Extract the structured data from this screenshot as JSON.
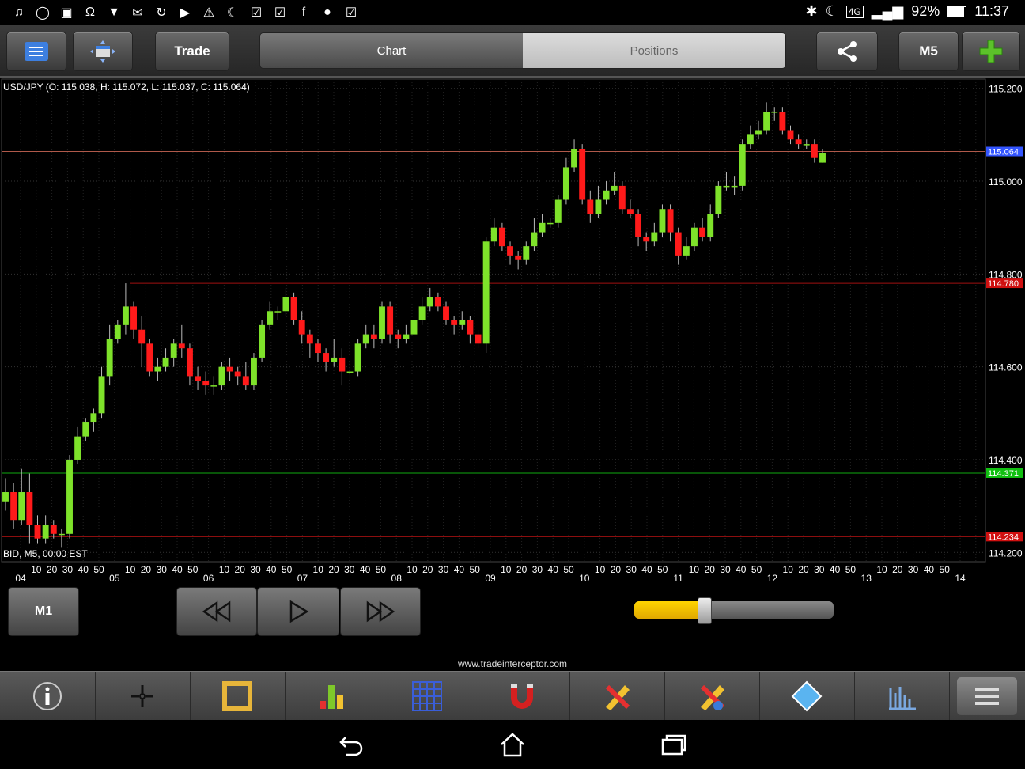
{
  "status_bar": {
    "left_icons": [
      "music-icon",
      "no-sim-icon",
      "image-icon",
      "headset-icon",
      "wifi-question-icon",
      "gmail-icon",
      "sync-icon",
      "youtube-icon",
      "warning-icon",
      "moon-icon",
      "task-icon",
      "task-check-icon",
      "facebook-icon",
      "messenger-icon",
      "task-done-icon"
    ],
    "network": "4G",
    "battery": "92%",
    "time": "11:37"
  },
  "toolbar": {
    "trade_label": "Trade",
    "tabs": [
      {
        "label": "Chart",
        "active": true
      },
      {
        "label": "Positions",
        "active": false
      }
    ],
    "timeframe_label": "M5"
  },
  "chart": {
    "title": "USD/JPY (O: 115.038, H: 115.072, L: 115.037, C: 115.064)",
    "footer": "BID, M5, 00:00 EST",
    "colors": {
      "bull": "#7ee22a",
      "bear": "#ff1a1a",
      "grid": "#222222",
      "current": "#3355ff",
      "resistance": "#ff1a1a",
      "support": "#00cc00"
    },
    "price_labels": [
      "115.200",
      "115.000",
      "114.800",
      "114.600",
      "114.400",
      "114.200"
    ],
    "line_labels": {
      "current": "115.064",
      "resistance": "114.780",
      "support": "114.371",
      "low": "114.234"
    },
    "day_labels": [
      "04",
      "05",
      "06",
      "07",
      "08",
      "09",
      "10",
      "11",
      "12",
      "13",
      "14"
    ],
    "minute_labels": [
      "10",
      "20",
      "30",
      "40",
      "50"
    ]
  },
  "chart_data": {
    "type": "candlestick",
    "title": "USD/JPY (O: 115.038, H: 115.072, L: 115.037, C: 115.064)",
    "ylim": [
      114.18,
      115.22
    ],
    "current_price": 115.064,
    "horizontal_lines": [
      115.064,
      114.78,
      114.371,
      114.234
    ],
    "candles": [
      [
        114.31,
        114.33,
        114.36,
        114.29
      ],
      [
        114.33,
        114.27,
        114.35,
        114.25
      ],
      [
        114.27,
        114.33,
        114.38,
        114.26
      ],
      [
        114.33,
        114.26,
        114.37,
        114.22
      ],
      [
        114.26,
        114.23,
        114.28,
        114.22
      ],
      [
        114.23,
        114.26,
        114.28,
        114.22
      ],
      [
        114.26,
        114.24,
        114.27,
        114.23
      ],
      [
        114.24,
        114.24,
        114.25,
        114.21
      ],
      [
        114.24,
        114.4,
        114.41,
        114.23
      ],
      [
        114.4,
        114.45,
        114.47,
        114.39
      ],
      [
        114.45,
        114.48,
        114.49,
        114.44
      ],
      [
        114.48,
        114.5,
        114.51,
        114.46
      ],
      [
        114.5,
        114.58,
        114.6,
        114.49
      ],
      [
        114.58,
        114.66,
        114.69,
        114.56
      ],
      [
        114.66,
        114.69,
        114.7,
        114.65
      ],
      [
        114.69,
        114.73,
        114.78,
        114.67
      ],
      [
        114.73,
        114.68,
        114.74,
        114.66
      ],
      [
        114.68,
        114.65,
        114.71,
        114.6
      ],
      [
        114.65,
        114.59,
        114.66,
        114.58
      ],
      [
        114.59,
        114.6,
        114.62,
        114.57
      ],
      [
        114.6,
        114.62,
        114.64,
        114.59
      ],
      [
        114.62,
        114.65,
        114.66,
        114.6
      ],
      [
        114.65,
        114.64,
        114.69,
        114.62
      ],
      [
        114.64,
        114.58,
        114.65,
        114.56
      ],
      [
        114.58,
        114.57,
        114.6,
        114.55
      ],
      [
        114.57,
        114.56,
        114.59,
        114.54
      ],
      [
        114.56,
        114.56,
        114.58,
        114.54
      ],
      [
        114.56,
        114.6,
        114.61,
        114.55
      ],
      [
        114.6,
        114.59,
        114.62,
        114.57
      ],
      [
        114.59,
        114.58,
        114.6,
        114.56
      ],
      [
        114.58,
        114.56,
        114.61,
        114.55
      ],
      [
        114.56,
        114.62,
        114.63,
        114.55
      ],
      [
        114.62,
        114.69,
        114.7,
        114.61
      ],
      [
        114.69,
        114.72,
        114.74,
        114.68
      ],
      [
        114.72,
        114.72,
        114.73,
        114.7
      ],
      [
        114.72,
        114.75,
        114.77,
        114.71
      ],
      [
        114.75,
        114.7,
        114.76,
        114.69
      ],
      [
        114.7,
        114.67,
        114.72,
        114.65
      ],
      [
        114.67,
        114.65,
        114.68,
        114.62
      ],
      [
        114.65,
        114.63,
        114.66,
        114.61
      ],
      [
        114.63,
        114.61,
        114.64,
        114.59
      ],
      [
        114.61,
        114.62,
        114.66,
        114.6
      ],
      [
        114.62,
        114.59,
        114.64,
        114.56
      ],
      [
        114.59,
        114.59,
        114.61,
        114.57
      ],
      [
        114.59,
        114.65,
        114.66,
        114.58
      ],
      [
        114.65,
        114.67,
        114.69,
        114.64
      ],
      [
        114.67,
        114.66,
        114.69,
        114.64
      ],
      [
        114.66,
        114.73,
        114.74,
        114.65
      ],
      [
        114.73,
        114.67,
        114.74,
        114.65
      ],
      [
        114.67,
        114.66,
        114.68,
        114.64
      ],
      [
        114.66,
        114.67,
        114.69,
        114.65
      ],
      [
        114.67,
        114.7,
        114.72,
        114.66
      ],
      [
        114.7,
        114.73,
        114.75,
        114.69
      ],
      [
        114.73,
        114.75,
        114.77,
        114.72
      ],
      [
        114.75,
        114.73,
        114.76,
        114.72
      ],
      [
        114.73,
        114.7,
        114.74,
        114.69
      ],
      [
        114.7,
        114.69,
        114.71,
        114.67
      ],
      [
        114.69,
        114.7,
        114.72,
        114.68
      ],
      [
        114.7,
        114.67,
        114.71,
        114.65
      ],
      [
        114.67,
        114.65,
        114.68,
        114.64
      ],
      [
        114.65,
        114.87,
        114.88,
        114.63
      ],
      [
        114.87,
        114.9,
        114.92,
        114.86
      ],
      [
        114.9,
        114.86,
        114.91,
        114.85
      ],
      [
        114.86,
        114.84,
        114.87,
        114.82
      ],
      [
        114.84,
        114.83,
        114.85,
        114.81
      ],
      [
        114.83,
        114.86,
        114.87,
        114.82
      ],
      [
        114.86,
        114.89,
        114.92,
        114.85
      ],
      [
        114.89,
        114.91,
        114.93,
        114.88
      ],
      [
        114.91,
        114.91,
        114.92,
        114.9
      ],
      [
        114.91,
        114.96,
        114.97,
        114.9
      ],
      [
        114.96,
        115.03,
        115.05,
        114.95
      ],
      [
        115.03,
        115.07,
        115.09,
        115.02
      ],
      [
        115.07,
        114.96,
        115.08,
        114.95
      ],
      [
        114.96,
        114.93,
        114.98,
        114.91
      ],
      [
        114.93,
        114.96,
        114.99,
        114.92
      ],
      [
        114.96,
        114.98,
        115.0,
        114.95
      ],
      [
        114.98,
        114.99,
        115.02,
        114.97
      ],
      [
        114.99,
        114.94,
        115.0,
        114.93
      ],
      [
        114.94,
        114.93,
        114.96,
        114.92
      ],
      [
        114.93,
        114.88,
        114.94,
        114.86
      ],
      [
        114.88,
        114.87,
        114.89,
        114.85
      ],
      [
        114.87,
        114.89,
        114.91,
        114.86
      ],
      [
        114.89,
        114.94,
        114.95,
        114.88
      ],
      [
        114.94,
        114.89,
        114.95,
        114.87
      ],
      [
        114.89,
        114.84,
        114.9,
        114.82
      ],
      [
        114.84,
        114.86,
        114.88,
        114.83
      ],
      [
        114.86,
        114.9,
        114.91,
        114.85
      ],
      [
        114.9,
        114.88,
        114.92,
        114.87
      ],
      [
        114.88,
        114.93,
        114.95,
        114.87
      ],
      [
        114.93,
        114.99,
        115.0,
        114.92
      ],
      [
        114.99,
        114.99,
        115.02,
        114.98
      ],
      [
        114.99,
        114.99,
        115.01,
        114.97
      ],
      [
        114.99,
        115.08,
        115.09,
        114.98
      ],
      [
        115.08,
        115.1,
        115.12,
        115.07
      ],
      [
        115.1,
        115.11,
        115.13,
        115.09
      ],
      [
        115.11,
        115.15,
        115.17,
        115.1
      ],
      [
        115.15,
        115.15,
        115.16,
        115.13
      ],
      [
        115.15,
        115.11,
        115.16,
        115.1
      ],
      [
        115.11,
        115.09,
        115.12,
        115.08
      ],
      [
        115.09,
        115.08,
        115.1,
        115.07
      ],
      [
        115.08,
        115.08,
        115.09,
        115.07
      ],
      [
        115.08,
        115.05,
        115.09,
        115.04
      ],
      [
        115.04,
        115.06,
        115.07,
        115.04
      ]
    ]
  },
  "controls": {
    "m1_label": "M1",
    "slider_value": 0.35
  },
  "website": "www.tradeinterceptor.com",
  "bottom_bar": [
    "info-icon",
    "crosshair-icon",
    "ruler-frame-icon",
    "bar-chart-icon",
    "grid-icon",
    "magnet-icon",
    "pencil-ruler-icon",
    "pencil-info-icon",
    "eraser-icon",
    "indicator-chart-icon",
    "menu-icon"
  ],
  "nav": [
    "back-icon",
    "home-icon",
    "recents-icon"
  ]
}
